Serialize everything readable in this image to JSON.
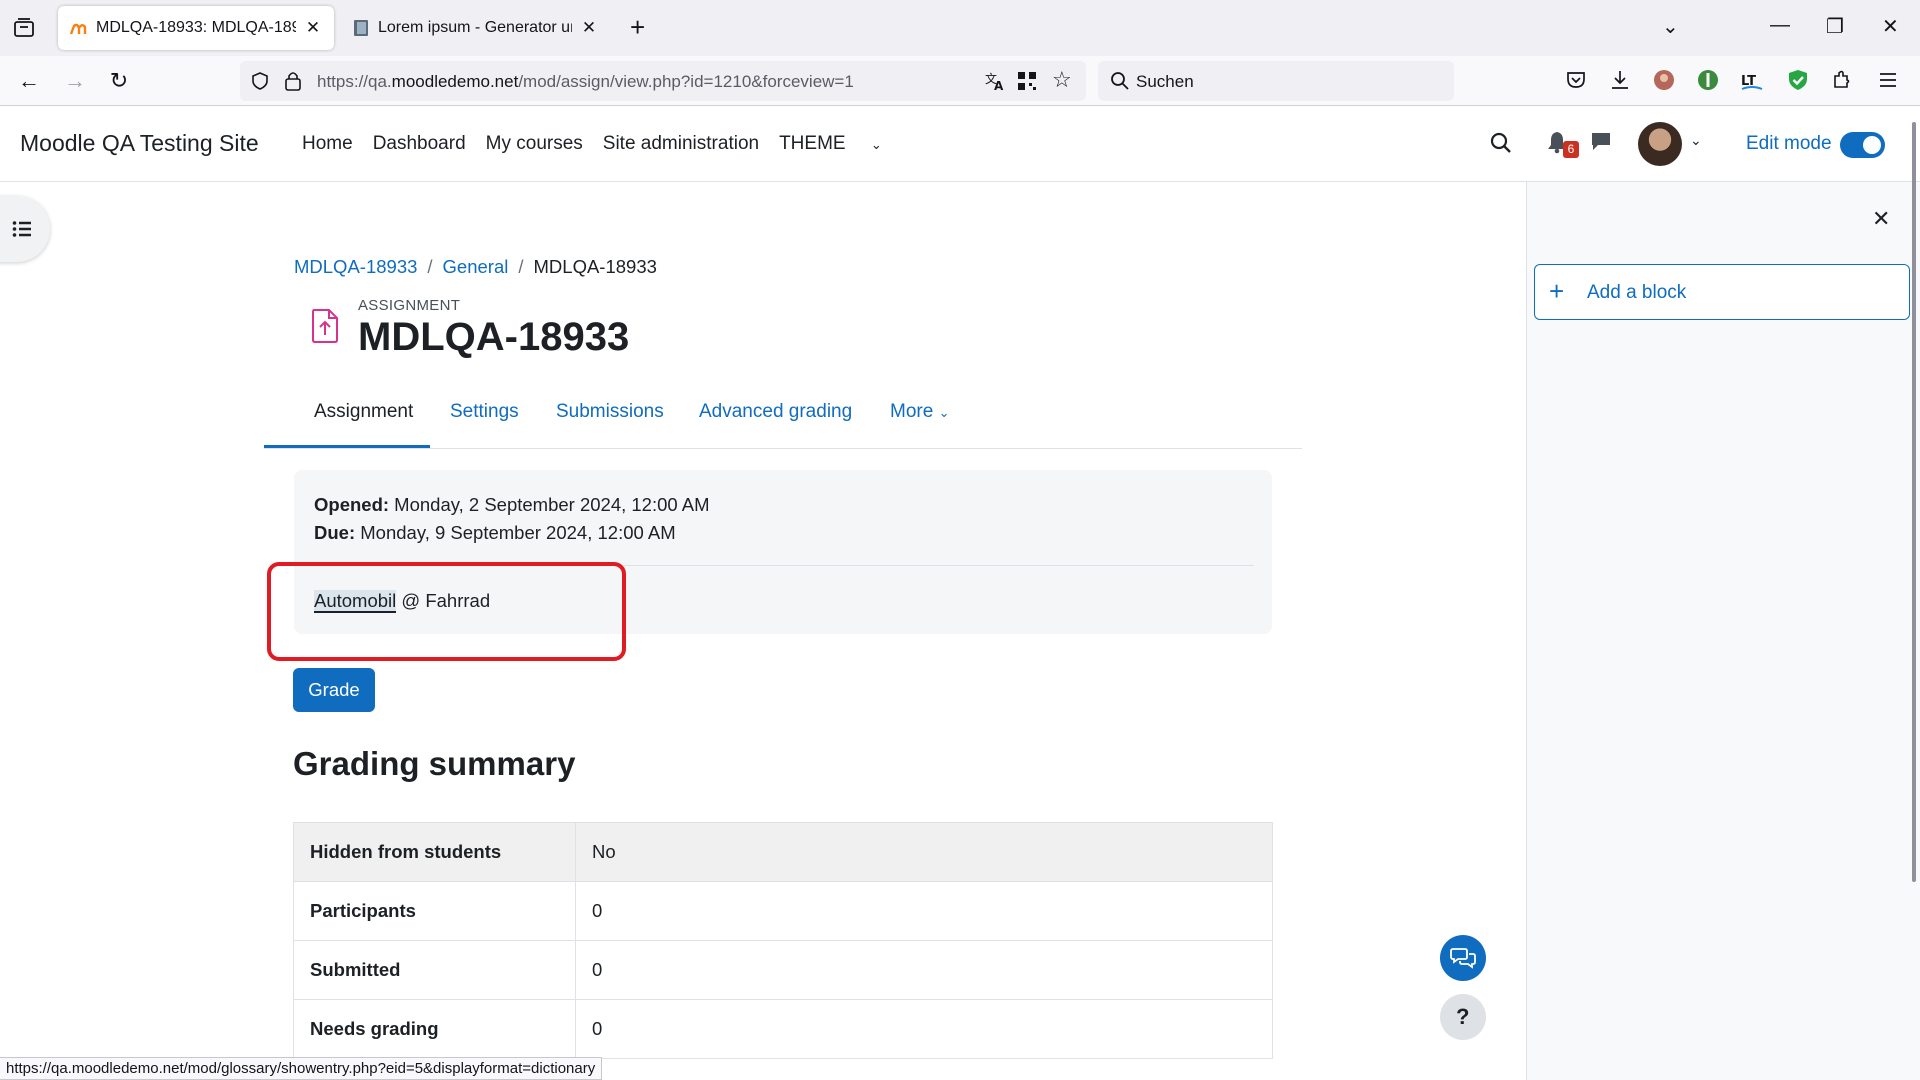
{
  "browser": {
    "tabs": [
      {
        "title": "MDLQA-18933: MDLQA-18933",
        "active": true
      },
      {
        "title": "Lorem ipsum - Generator und Info",
        "active": false
      }
    ],
    "url_prefix": "https://qa.",
    "url_domain": "moodledemo.net",
    "url_path": "/mod/assign/view.php?id=1210&forceview=1",
    "search_placeholder": "Suchen",
    "status_url": "https://qa.moodledemo.net/mod/glossary/showentry.php?eid=5&displayformat=dictionary"
  },
  "header": {
    "site_name": "Moodle QA Testing Site",
    "nav": [
      "Home",
      "Dashboard",
      "My courses",
      "Site administration",
      "THEME"
    ],
    "notification_count": "6",
    "edit_mode_label": "Edit mode"
  },
  "blocks": {
    "add_block_label": "Add a block"
  },
  "breadcrumb": [
    "MDLQA-18933",
    "General",
    "MDLQA-18933"
  ],
  "page": {
    "module_type": "ASSIGNMENT",
    "title": "MDLQA-18933",
    "tabs": [
      "Assignment",
      "Settings",
      "Submissions",
      "Advanced grading",
      "More"
    ],
    "opened_label": "Opened:",
    "opened_value": "Monday, 2 September 2024, 12:00 AM",
    "due_label": "Due:",
    "due_value": "Monday, 9 September 2024, 12:00 AM",
    "intro_link": "Automobil",
    "intro_rest": " @ Fahrrad",
    "grade_button": "Grade",
    "summary_heading": "Grading summary",
    "summary": [
      {
        "label": "Hidden from students",
        "value": "No"
      },
      {
        "label": "Participants",
        "value": "0"
      },
      {
        "label": "Submitted",
        "value": "0"
      },
      {
        "label": "Needs grading",
        "value": "0"
      }
    ]
  },
  "colors": {
    "accent": "#0f6cbf",
    "highlight_box": "#e01b24",
    "badge": "#ca3120"
  }
}
